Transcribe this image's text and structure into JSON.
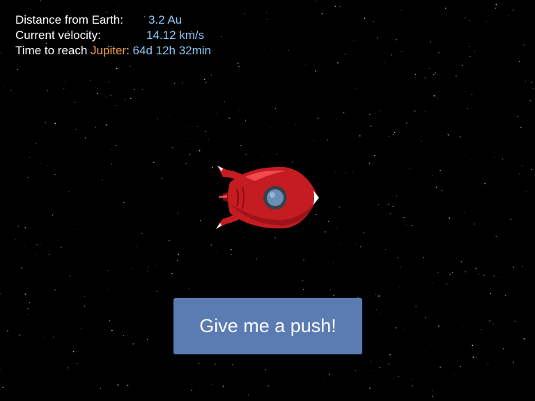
{
  "colors": {
    "background": "#000000",
    "label": "#ffffff",
    "value": "#8cc6f4",
    "planet": "#f7a046",
    "button_bg": "#5b7bb3",
    "button_text": "#ffffff",
    "rocket_body": "#c51c22",
    "rocket_dark": "#7a0d12",
    "rocket_highlight": "#f04a4f",
    "rocket_window": "#6a8fb6",
    "rocket_window_rim": "#3a3f48"
  },
  "hud": {
    "distance": {
      "label": "Distance from Earth:",
      "value": "3.2 Au"
    },
    "velocity": {
      "label": "Current velocity:",
      "value": "14.12 km/s"
    },
    "time": {
      "label_prefix": "Time to reach ",
      "planet": "Jupiter",
      "label_suffix": ":",
      "value": "64d 12h 32min"
    }
  },
  "rocket": {
    "icon": "rocket-ship-icon"
  },
  "push_button": {
    "label": "Give me a push!"
  }
}
